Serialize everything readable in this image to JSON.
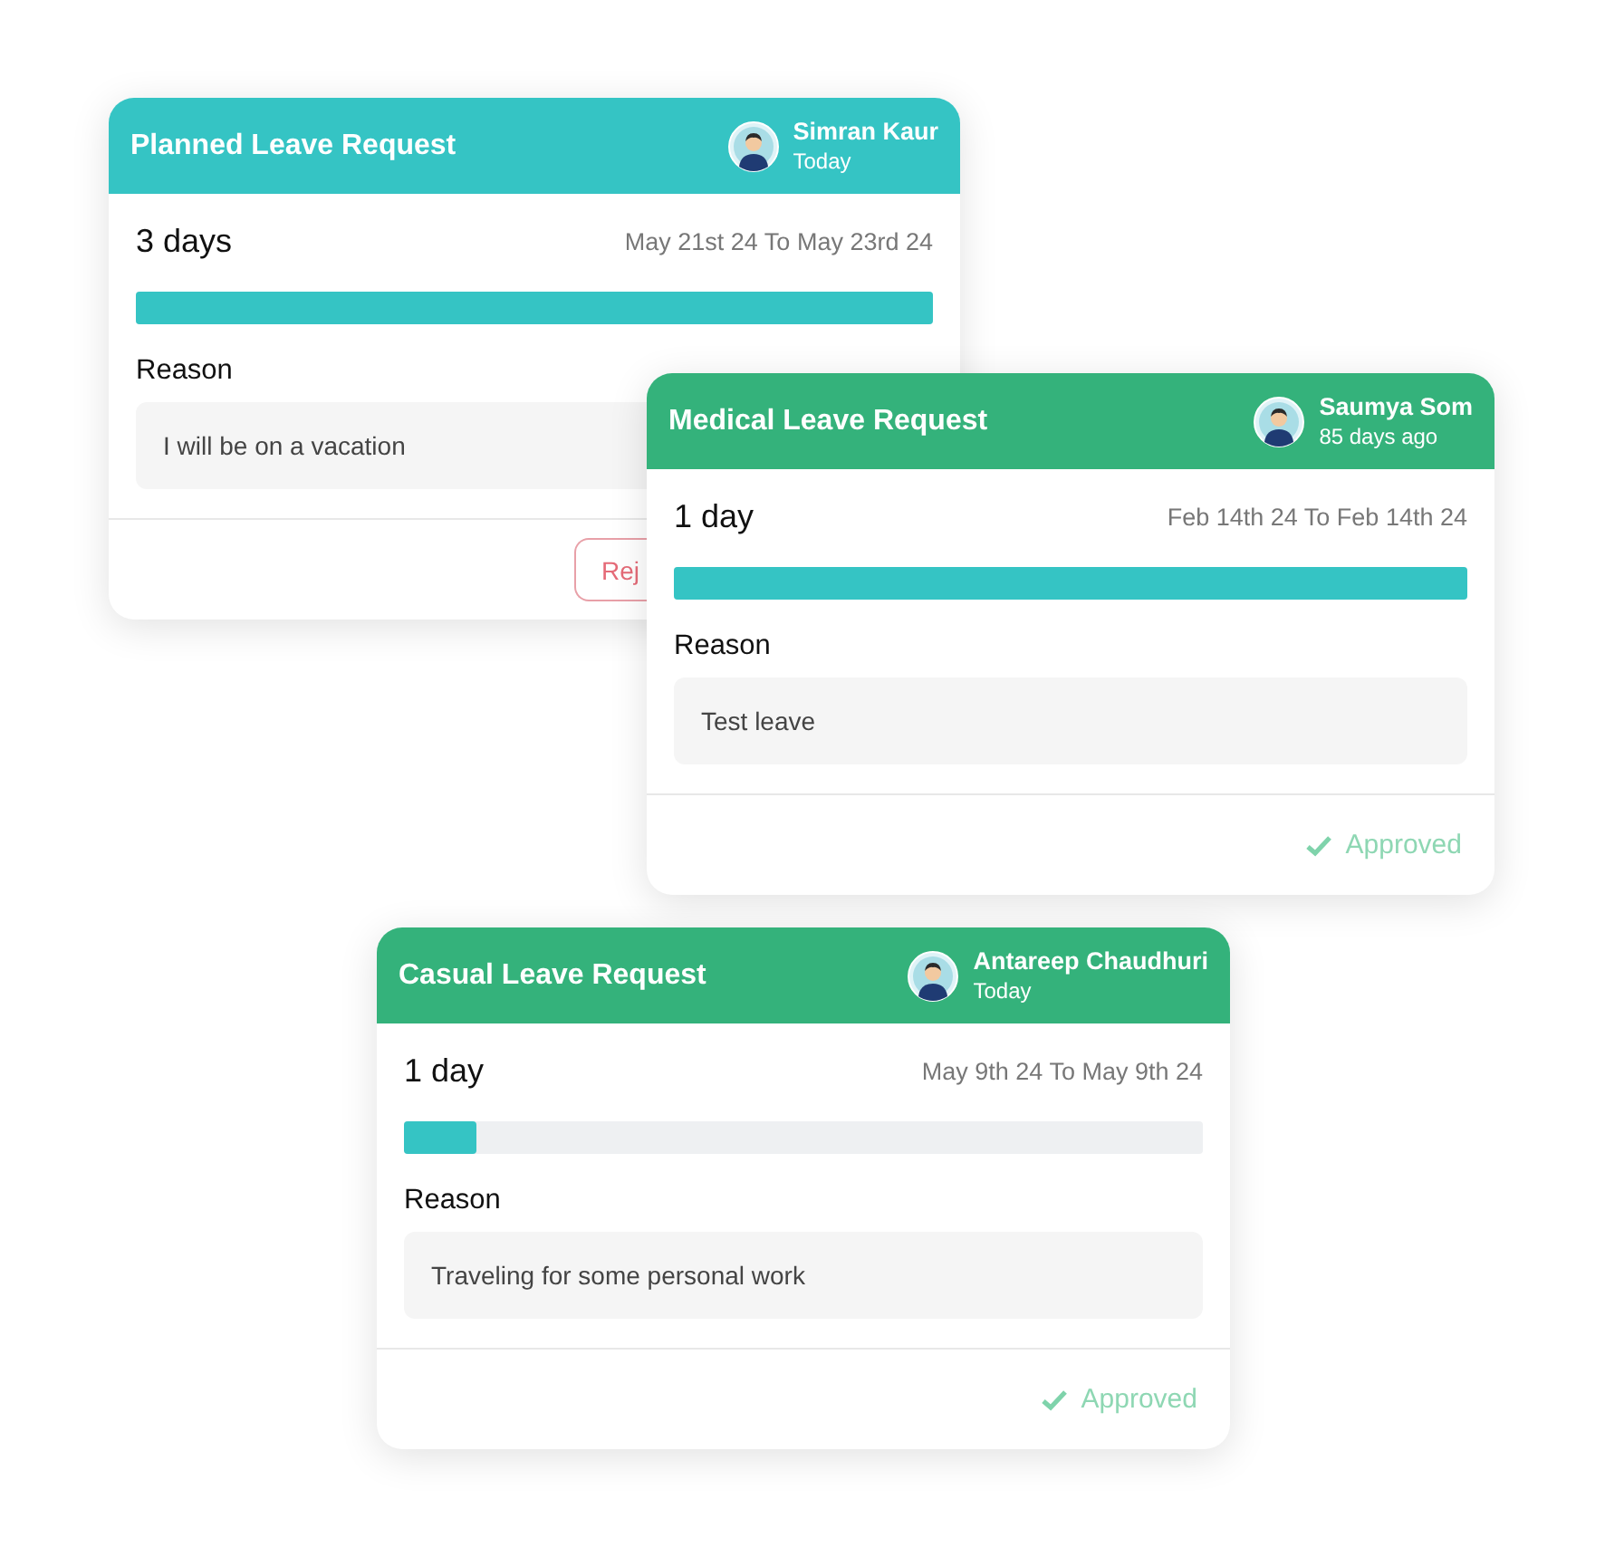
{
  "cards": [
    {
      "title": "Planned Leave Request",
      "color": "#35c4c4",
      "user": {
        "name": "Simran Kaur",
        "time": "Today"
      },
      "duration": "3 days",
      "dates": "May 21st 24 To May 23rd 24",
      "level": 1,
      "reason_label": "Reason",
      "reason": "I will be on a vacation",
      "footer": {
        "kind": "button",
        "label": "Rej"
      }
    },
    {
      "title": "Medical Leave Request",
      "color": "#34b27b",
      "user": {
        "name": "Saumya Som",
        "time": "85 days ago"
      },
      "duration": "1 day",
      "dates": "Feb 14th 24 To Feb 14th 24",
      "level": 1,
      "reason_label": "Reason",
      "reason": "Test leave",
      "footer": {
        "kind": "status",
        "label": "Approved"
      }
    },
    {
      "title": "Casual Leave Request",
      "color": "#34b27b",
      "user": {
        "name": "Antareep Chaudhuri",
        "time": "Today"
      },
      "duration": "1 day",
      "dates": "May 9th 24 To May 9th 24",
      "level": 0.09,
      "reason_label": "Reason",
      "reason": "Traveling for some personal work",
      "footer": {
        "kind": "status",
        "label": "Approved"
      }
    }
  ]
}
